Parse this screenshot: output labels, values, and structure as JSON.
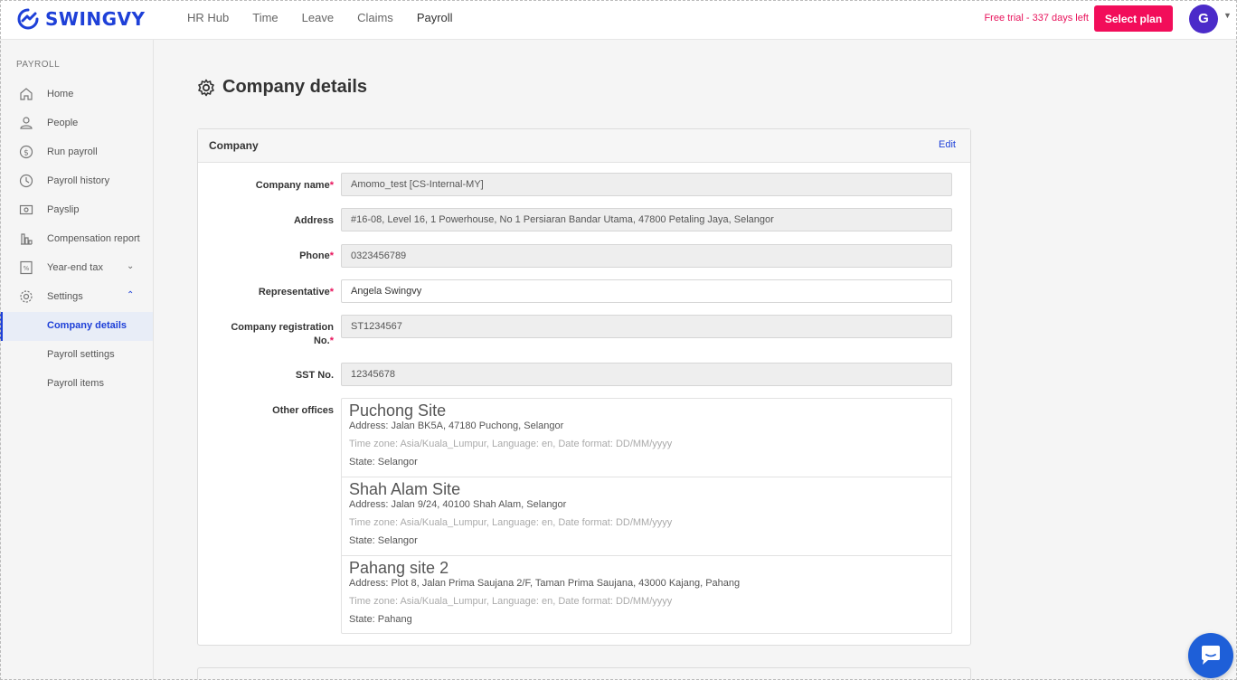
{
  "brand": {
    "name": "SWINGVY",
    "color": "#1e40d8",
    "accent": "#f20d5a"
  },
  "topnav": {
    "items": [
      {
        "label": "HR Hub"
      },
      {
        "label": "Time"
      },
      {
        "label": "Leave"
      },
      {
        "label": "Claims"
      },
      {
        "label": "Payroll"
      }
    ],
    "trial_text": "Free trial - 337 days left",
    "select_plan_label": "Select plan",
    "avatar_initial": "G"
  },
  "sidebar": {
    "heading": "PAYROLL",
    "items": [
      {
        "label": "Home",
        "icon": "home-icon"
      },
      {
        "label": "People",
        "icon": "person-icon"
      },
      {
        "label": "Run payroll",
        "icon": "dollar-circle-icon"
      },
      {
        "label": "Payroll history",
        "icon": "history-icon"
      },
      {
        "label": "Payslip",
        "icon": "payslip-icon"
      },
      {
        "label": "Compensation report",
        "icon": "bar-chart-icon"
      },
      {
        "label": "Year-end tax",
        "icon": "percent-icon"
      },
      {
        "label": "Settings",
        "icon": "gear-icon"
      },
      {
        "label": "Company details"
      },
      {
        "label": "Payroll settings"
      },
      {
        "label": "Payroll items"
      }
    ]
  },
  "page": {
    "title": "Company details"
  },
  "company_card": {
    "title": "Company",
    "edit_label": "Edit",
    "fields": {
      "company_name": {
        "label": "Company name",
        "value": "Amomo_test [CS-Internal-MY]"
      },
      "address": {
        "label": "Address",
        "value": "#16-08, Level 16, 1 Powerhouse, No 1 Persiaran Bandar Utama, 47800 Petaling Jaya, Selangor"
      },
      "phone": {
        "label": "Phone",
        "value": "0323456789"
      },
      "representative": {
        "label": "Representative",
        "value": "Angela Swingvy"
      },
      "registration": {
        "label_line1": "Company registration",
        "label_line2": "No.",
        "value": "ST1234567"
      },
      "sst": {
        "label": "SST No.",
        "value": "12345678"
      },
      "other_offices_label": "Other offices"
    },
    "required_mark": "*",
    "offices": [
      {
        "name": "Puchong Site",
        "address": "Address: Jalan BK5A, 47180 Puchong, Selangor",
        "meta": "Time zone: Asia/Kuala_Lumpur, Language: en, Date format: DD/MM/yyyy",
        "state": "State: Selangor"
      },
      {
        "name": "Shah Alam Site",
        "address": "Address: Jalan 9/24, 40100 Shah Alam, Selangor",
        "meta": "Time zone: Asia/Kuala_Lumpur, Language: en, Date format: DD/MM/yyyy",
        "state": "State: Selangor"
      },
      {
        "name": "Pahang site 2",
        "address": "Address: Plot 8, Jalan Prima Saujana 2/F, Taman Prima Saujana, 43000 Kajang, Pahang",
        "meta": "Time zone: Asia/Kuala_Lumpur, Language: en, Date format: DD/MM/yyyy",
        "state": "State: Pahang"
      }
    ]
  }
}
